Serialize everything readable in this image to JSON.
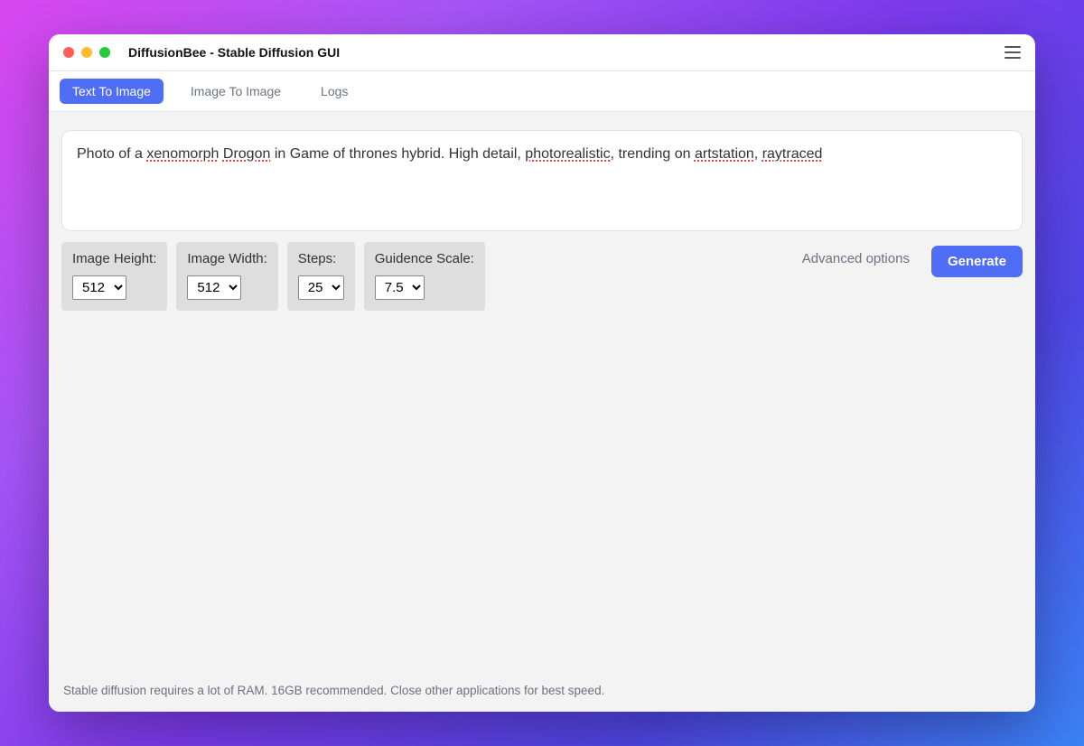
{
  "window": {
    "title": "DiffusionBee - Stable Diffusion GUI"
  },
  "tabs": {
    "text_to_image": "Text To Image",
    "image_to_image": "Image To Image",
    "logs": "Logs",
    "active": "text_to_image"
  },
  "prompt": {
    "text_parts": [
      "Photo of a ",
      "xenomorph",
      " ",
      "Drogon",
      " in Game of thrones hybrid. High detail, ",
      "photorealistic",
      ", trending on ",
      "artstation",
      ", ",
      "raytraced"
    ]
  },
  "params": {
    "image_height": {
      "label": "Image Height:",
      "value": "512"
    },
    "image_width": {
      "label": "Image Width:",
      "value": "512"
    },
    "steps": {
      "label": "Steps:",
      "value": "25"
    },
    "guidance_scale": {
      "label": "Guidence Scale:",
      "value": "7.5"
    }
  },
  "actions": {
    "advanced_options": "Advanced options",
    "generate": "Generate"
  },
  "footer": {
    "note": "Stable diffusion requires a lot of RAM. 16GB recommended. Close other applications for best speed."
  }
}
